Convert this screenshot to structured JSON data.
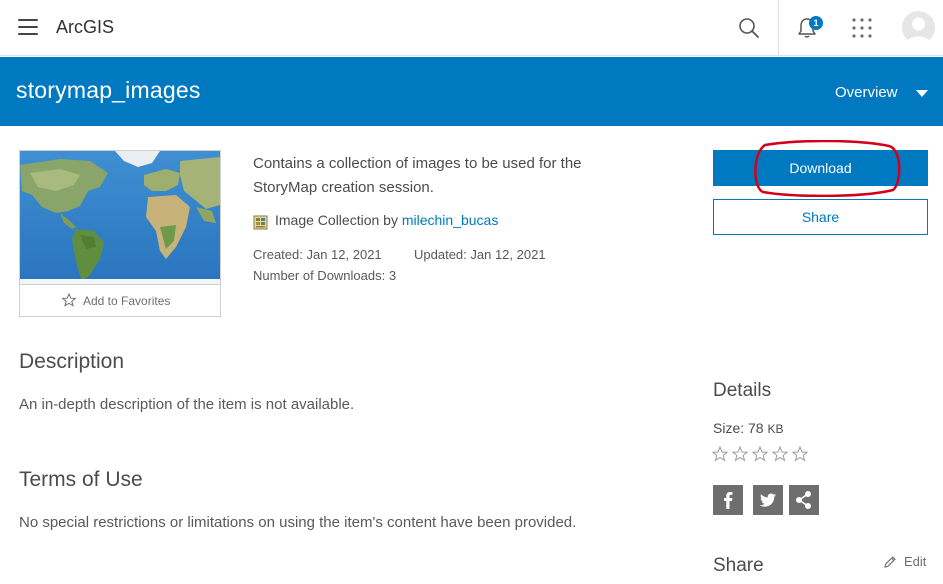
{
  "app": {
    "title": "ArcGIS"
  },
  "notifications": {
    "count": "1"
  },
  "header": {
    "item_title": "storymap_images",
    "tab_label": "Overview"
  },
  "thumbnail": {
    "favorites_label": "Add to Favorites"
  },
  "summary": {
    "text": "Contains a collection of images to be used for the StoryMap creation session.",
    "type_prefix": "Image Collection by",
    "owner": "milechin_bucas",
    "created": "Created: Jan 12, 2021",
    "updated": "Updated: Jan 12, 2021",
    "downloads": "Number of Downloads: 3"
  },
  "actions": {
    "download_label": "Download",
    "share_label": "Share",
    "annotation_color": "#d0021b"
  },
  "description": {
    "heading": "Description",
    "text": "An in-depth description of the item is not available."
  },
  "terms": {
    "heading": "Terms of Use",
    "text": "No special restrictions or limitations on using the item's content have been provided."
  },
  "details": {
    "heading": "Details",
    "size_prefix": "Size: 78",
    "size_unit": "KB",
    "rating": 0,
    "rating_max": 5,
    "social": [
      "facebook-icon",
      "twitter-icon",
      "share-icon"
    ]
  },
  "share_section": {
    "heading": "Share",
    "edit_label": "Edit"
  },
  "colors": {
    "brand": "#0079c1",
    "text": "#4c4c4c"
  }
}
